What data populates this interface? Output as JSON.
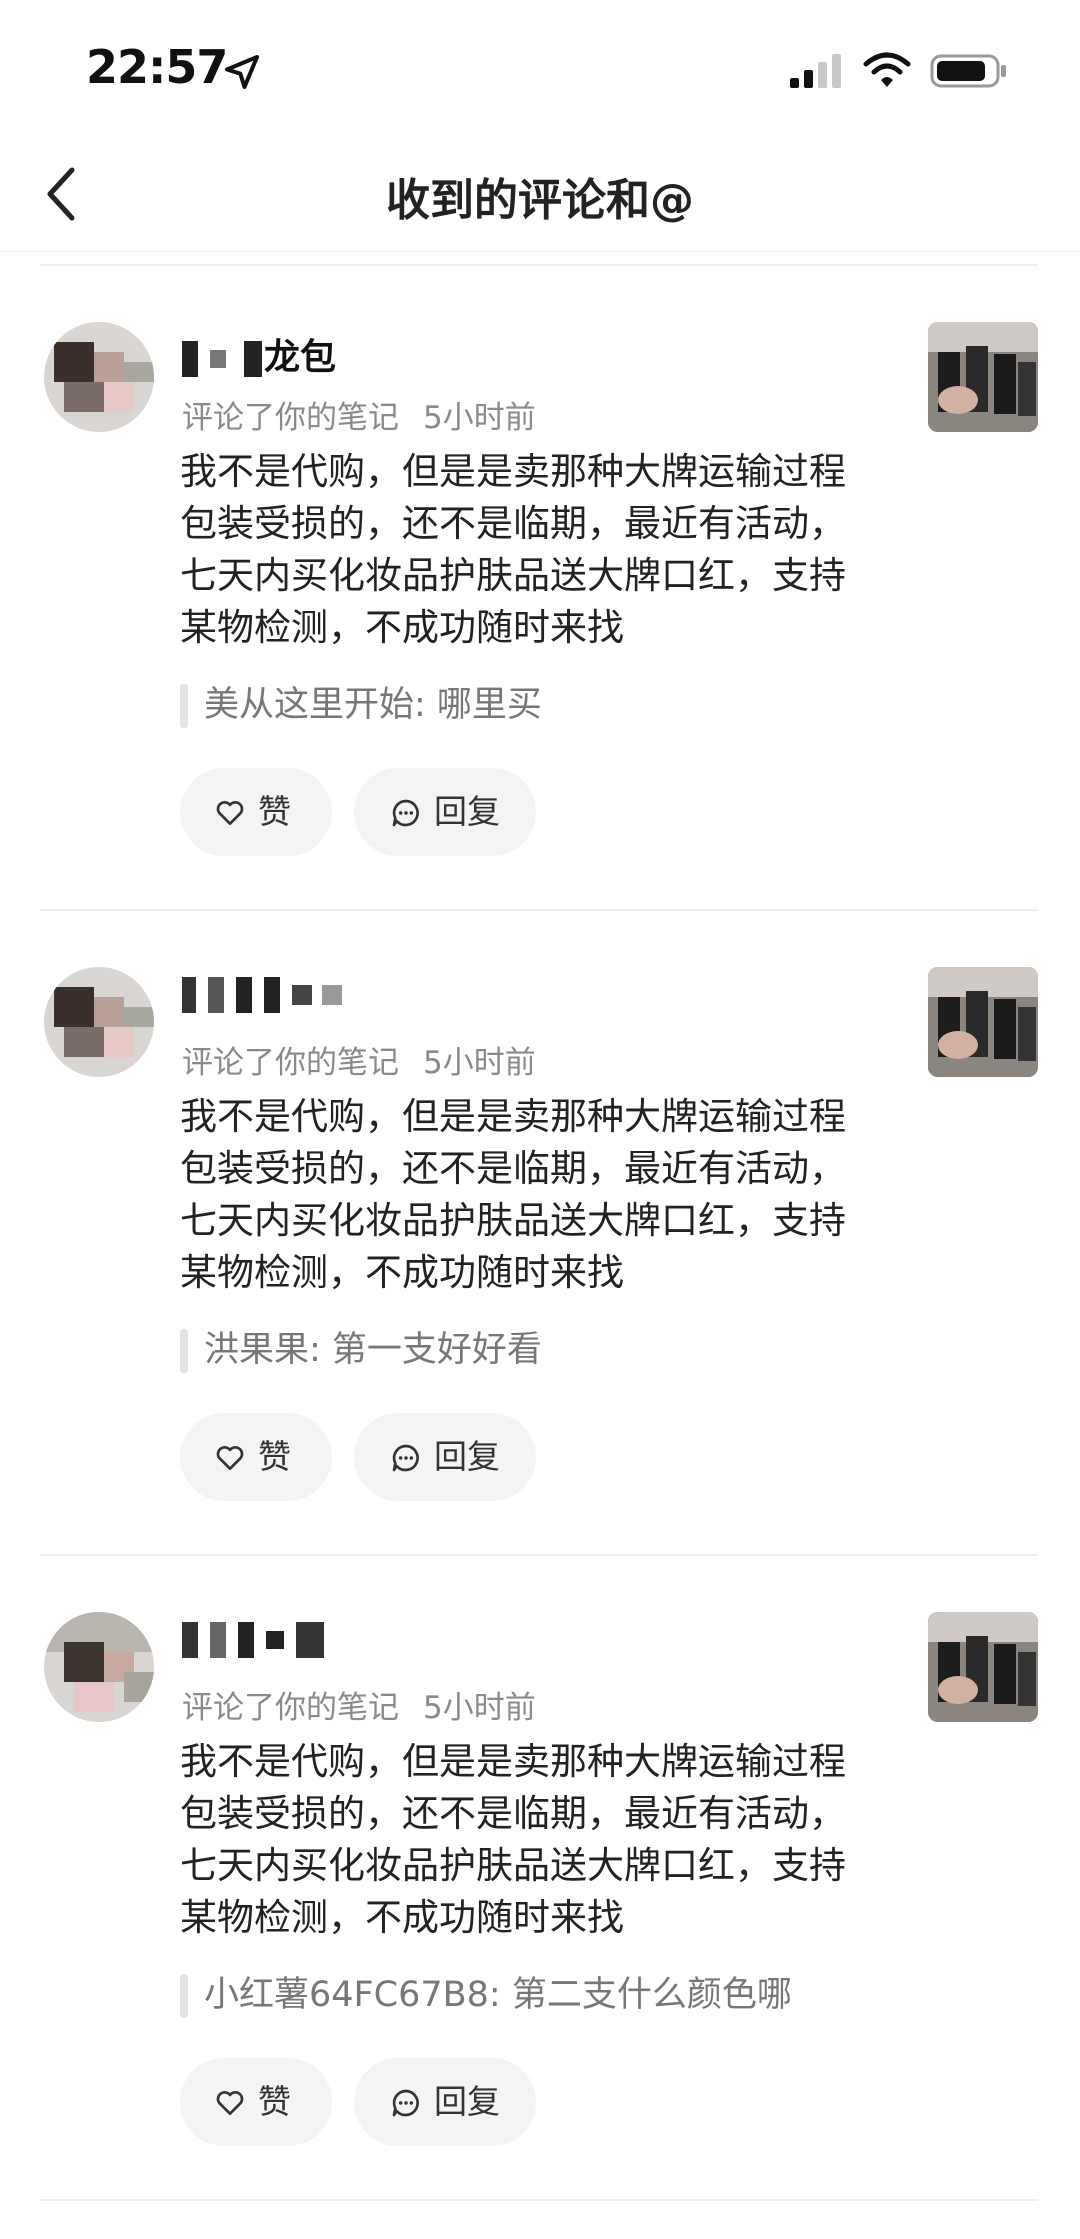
{
  "status_bar": {
    "time": "22:57",
    "icons": [
      "location-arrow-icon",
      "cellular-signal-icon",
      "wifi-icon",
      "battery-icon"
    ]
  },
  "nav": {
    "title": "收到的评论和@",
    "back_icon": "chevron-left-icon"
  },
  "actions": {
    "like_label": "赞",
    "reply_label": "回复"
  },
  "comments": [
    {
      "username_visible": "龙包",
      "action_text": "评论了你的笔记",
      "time": "5小时前",
      "body": "我不是代购，但是是卖那种大牌运输过程包装受损的，还不是临期，最近有活动，七天内买化妆品护肤品送大牌口红，支持某物检测，不成功随时来找",
      "quote": "美从这里开始: 哪里买"
    },
    {
      "username_visible": "",
      "action_text": "评论了你的笔记",
      "time": "5小时前",
      "body": "我不是代购，但是是卖那种大牌运输过程包装受损的，还不是临期，最近有活动，七天内买化妆品护肤品送大牌口红，支持某物检测，不成功随时来找",
      "quote": "洪果果: 第一支好好看"
    },
    {
      "username_visible": "",
      "action_text": "评论了你的笔记",
      "time": "5小时前",
      "body": "我不是代购，但是是卖那种大牌运输过程包装受损的，还不是临期，最近有活动，七天内买化妆品护肤品送大牌口红，支持某物检测，不成功随时来找",
      "quote": "小红薯64FC67B8: 第二支什么颜色哪"
    }
  ]
}
